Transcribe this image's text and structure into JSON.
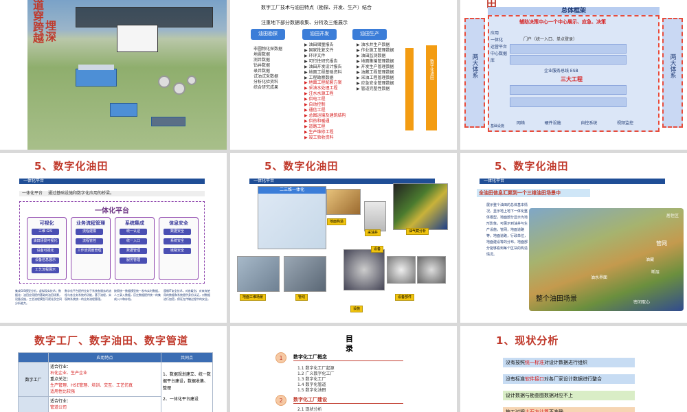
{
  "slide1": {
    "title_chars": [
      "道",
      "穿",
      "跨",
      "越",
      "埋",
      "深"
    ]
  },
  "slide2": {
    "header": "数字工厂技术与油田特点（勘探、开发、生产）结合",
    "subheader": "注重地下部分数据收集、分析及三维展示",
    "boxes": [
      "油田勘探",
      "油田开发",
      "油田生产"
    ],
    "vertical_label": "数字化油田",
    "col1": [
      "非圆物化探数据",
      "地震数据",
      "测井数据",
      "钻井数据",
      "录井数据",
      "试油试采数据",
      "分析化验资料",
      "综合研究成果"
    ],
    "col2": [
      "油田储量报告",
      "国家批复文件",
      "环评文件",
      "可行性研究报告",
      "油田开发设计报告",
      "地面工程基础资料",
      "工程勘察数据"
    ],
    "col2_red": [
      "地面工程配套方案",
      "采油水处理工程",
      "注水水源工程",
      "供电工程",
      "自动控制",
      "通信工程",
      "总图运输及建筑结构",
      "供热和暖通",
      "道路工程",
      "生产维修工程",
      "竣工验收资料"
    ],
    "col3": [
      "油水井生产数据",
      "作业施工管理数据",
      "油田监测数据",
      "地面集输管理数据",
      "开发生产管理数据",
      "油藏工程管理数据",
      "采油工程管理数据",
      "应急安全管理数据",
      "管道完整性数据"
    ]
  },
  "slide3": {
    "title_char": "田",
    "heading": "总体框架",
    "center_text": "辅助决策中心一个中心展示、应急、决策",
    "portal": "门户（统一入口、单点登录）",
    "left_side": "两大体系",
    "right_side": "两大体系",
    "mid": "三大工程",
    "left_labels": [
      "应用",
      "一体化",
      "运营平台",
      "中心数据库"
    ],
    "esb": "企业服务总线 ESB",
    "bottom": [
      "网络",
      "硬件设施",
      "自控系统",
      "视频监控"
    ],
    "infra": "基础设施"
  },
  "slide4": {
    "title": "5、数字化油田",
    "subbar": "一体化平台",
    "intro_label": "一体化平台",
    "intro_text": "通过基础设施和数字化应用的桥梁。",
    "platform": "一体化平台",
    "groups": [
      {
        "name": "可视化",
        "items": [
          "三维 GIS",
          "油田场景可视化",
          "设备可视化",
          "设备信息展示",
          "工艺流程展示"
        ]
      },
      {
        "name": "业务流程管理",
        "items": [
          "流程建模",
          "流程管控",
          "工作流调度管理"
        ]
      },
      {
        "name": "系统集成",
        "items": [
          "统一认证",
          "统一入口",
          "数据管理",
          "服务管理"
        ]
      },
      {
        "name": "信息安全",
        "items": [
          "数据安全",
          "系统安全",
          "链路安全"
        ]
      }
    ],
    "notes": [
      "集成GIS模型分析，虚拟现实技术；数据化：油田应用提供基础的油田场景，设备设施，工艺流程模型可视化及空间分析能力。",
      "数字化平台提供业务于系统各服务的流程与各业务系统的功能，基于流程，实现跨系统统一的业务流程管理。",
      "按照统一数据模型统一发布实时数据，人工录入数据，历史数据提供统一的集成入口和存档。",
      "遵循IT安全技术，对各级别，对来宾使用的数据和系统提供身份认证，对数据进行加密，保证在传输过程中的安全。"
    ]
  },
  "slide5": {
    "title": "5、数字化油田",
    "subbar": "一体化平台",
    "inner_title": "二三维一体化",
    "labels": [
      "地面构造",
      "采油井",
      "油气藏分析",
      "地面三维场景",
      "设备",
      "设备部件",
      "管线",
      "设施"
    ]
  },
  "slide6": {
    "title": "5、数字化油田",
    "subbar": "一体化平台",
    "banner": "全油田信息汇聚到一个三维油田场景中",
    "text": "展示整个油田的总体基本情况，显示地上地下一体化整体模型，地面部分显示为地形影像，可展示到油井与生产设施，管网，地面道路等，地面道路，行政单位，地面建设等的分布，地面部分能够看到每个区块的构造情况。",
    "caption": "整个油田场景",
    "map_labels": [
      "管网",
      "居住区",
      "油藏",
      "断层",
      "油水界面",
      "密闭取心"
    ]
  },
  "slide7": {
    "title": "数字工厂、数字油田、数字管道",
    "headers": [
      "",
      "应用特点",
      "共同点"
    ],
    "rows": [
      {
        "cat": "数字工厂",
        "scope_label": "适合行业：",
        "scope": "石化企业、生产企业",
        "focus_label": "重点关注：",
        "focus": "生产管理、HSE管理、培训、交互、工艺仿真",
        "apply": "适用性比较强"
      },
      {
        "cat": "",
        "scope_label": "适合行业：",
        "scope": "管道公司",
        "focus_label": "",
        "focus": "",
        "apply": ""
      }
    ],
    "common": [
      "1、数据规划建立、统一数据平台建设，数据收集、整理",
      "2、一体化平台建设"
    ]
  },
  "slide8": {
    "title": "目录",
    "sections": [
      {
        "num": "1",
        "name": "数字化工厂概念",
        "items": [
          "1.1 数字化工厂起源",
          "1.2 广义数字化工厂",
          "1.3 数字化工厂",
          "1.4 数字化管道",
          "1.5 数字化油田"
        ]
      },
      {
        "num": "2",
        "name": "数字化工厂建设",
        "items": [
          "2.1 现状分析"
        ]
      }
    ]
  },
  "slide9": {
    "title": "1、现状分析",
    "bars": [
      {
        "pre": "没有按照",
        "hl": "统一标准",
        "post": "对设计数据进行组织",
        "color": "#c7dcf3"
      },
      {
        "pre": "没有标准",
        "hl": "软件接口",
        "post": "对各厂家设计数据进行整合",
        "color": "#c7dcf3"
      },
      {
        "pre": "设计数据与勘查图数据对应不上",
        "hl": "",
        "post": "",
        "color": "#d9edc6"
      },
      {
        "pre": "施工过程",
        "hl": "土石方计算",
        "post": "不准确",
        "color": "#f6d5b3"
      }
    ]
  }
}
